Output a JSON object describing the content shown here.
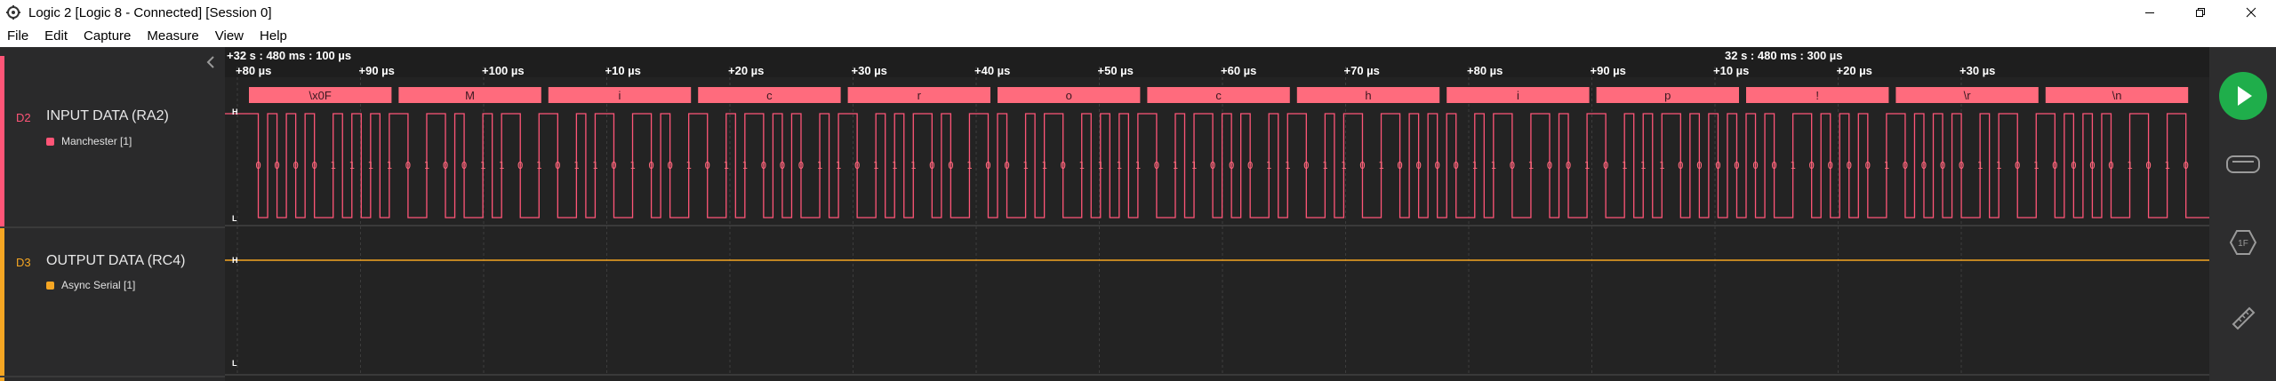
{
  "window": {
    "title": "Logic 2 [Logic 8 - Connected] [Session 0]",
    "controls": [
      "minimize-icon",
      "restore-icon",
      "close-icon"
    ]
  },
  "menu": {
    "items": [
      "File",
      "Edit",
      "Capture",
      "Measure",
      "View",
      "Help"
    ]
  },
  "timeline": {
    "anchor_left": "+32 s : 480 ms : 100 µs",
    "anchor_right": "32 s : 480 ms : 300 µs",
    "ticks": [
      "+80 µs",
      "+90 µs",
      "+100 µs",
      "+10 µs",
      "+20 µs",
      "+30 µs",
      "+40 µs",
      "+50 µs",
      "+60 µs",
      "+70 µs",
      "+80 µs",
      "+90 µs",
      "+10 µs",
      "+20 µs",
      "+30 µs"
    ]
  },
  "channels": [
    {
      "id": "D2",
      "name": "INPUT DATA (RA2)",
      "color": "#ff5577",
      "analyzer": "Manchester [1]",
      "analyzer_color": "#ff5577",
      "level_high": "H",
      "level_low": "L",
      "frames": [
        "\\x0F",
        "M",
        "i",
        "c",
        "r",
        "o",
        "c",
        "h",
        "i",
        "p",
        "!",
        "\\r",
        "\\n"
      ],
      "bits": "00001111010011010110100101100011011100100110111101100011011010000110100101110000001000010000110100001010"
    },
    {
      "id": "D3",
      "name": "OUTPUT DATA (RC4)",
      "color": "#f5a623",
      "analyzer": "Async Serial [1]",
      "analyzer_color": "#f5a623",
      "level_high": "H",
      "level_low": "L",
      "state": "high"
    }
  ],
  "sidebar": {
    "buttons": [
      "play-icon",
      "analyzer-icon",
      "1f-hex-icon",
      "ruler-icon"
    ],
    "hex_label": "1F",
    "accent": "#1fae4b"
  }
}
